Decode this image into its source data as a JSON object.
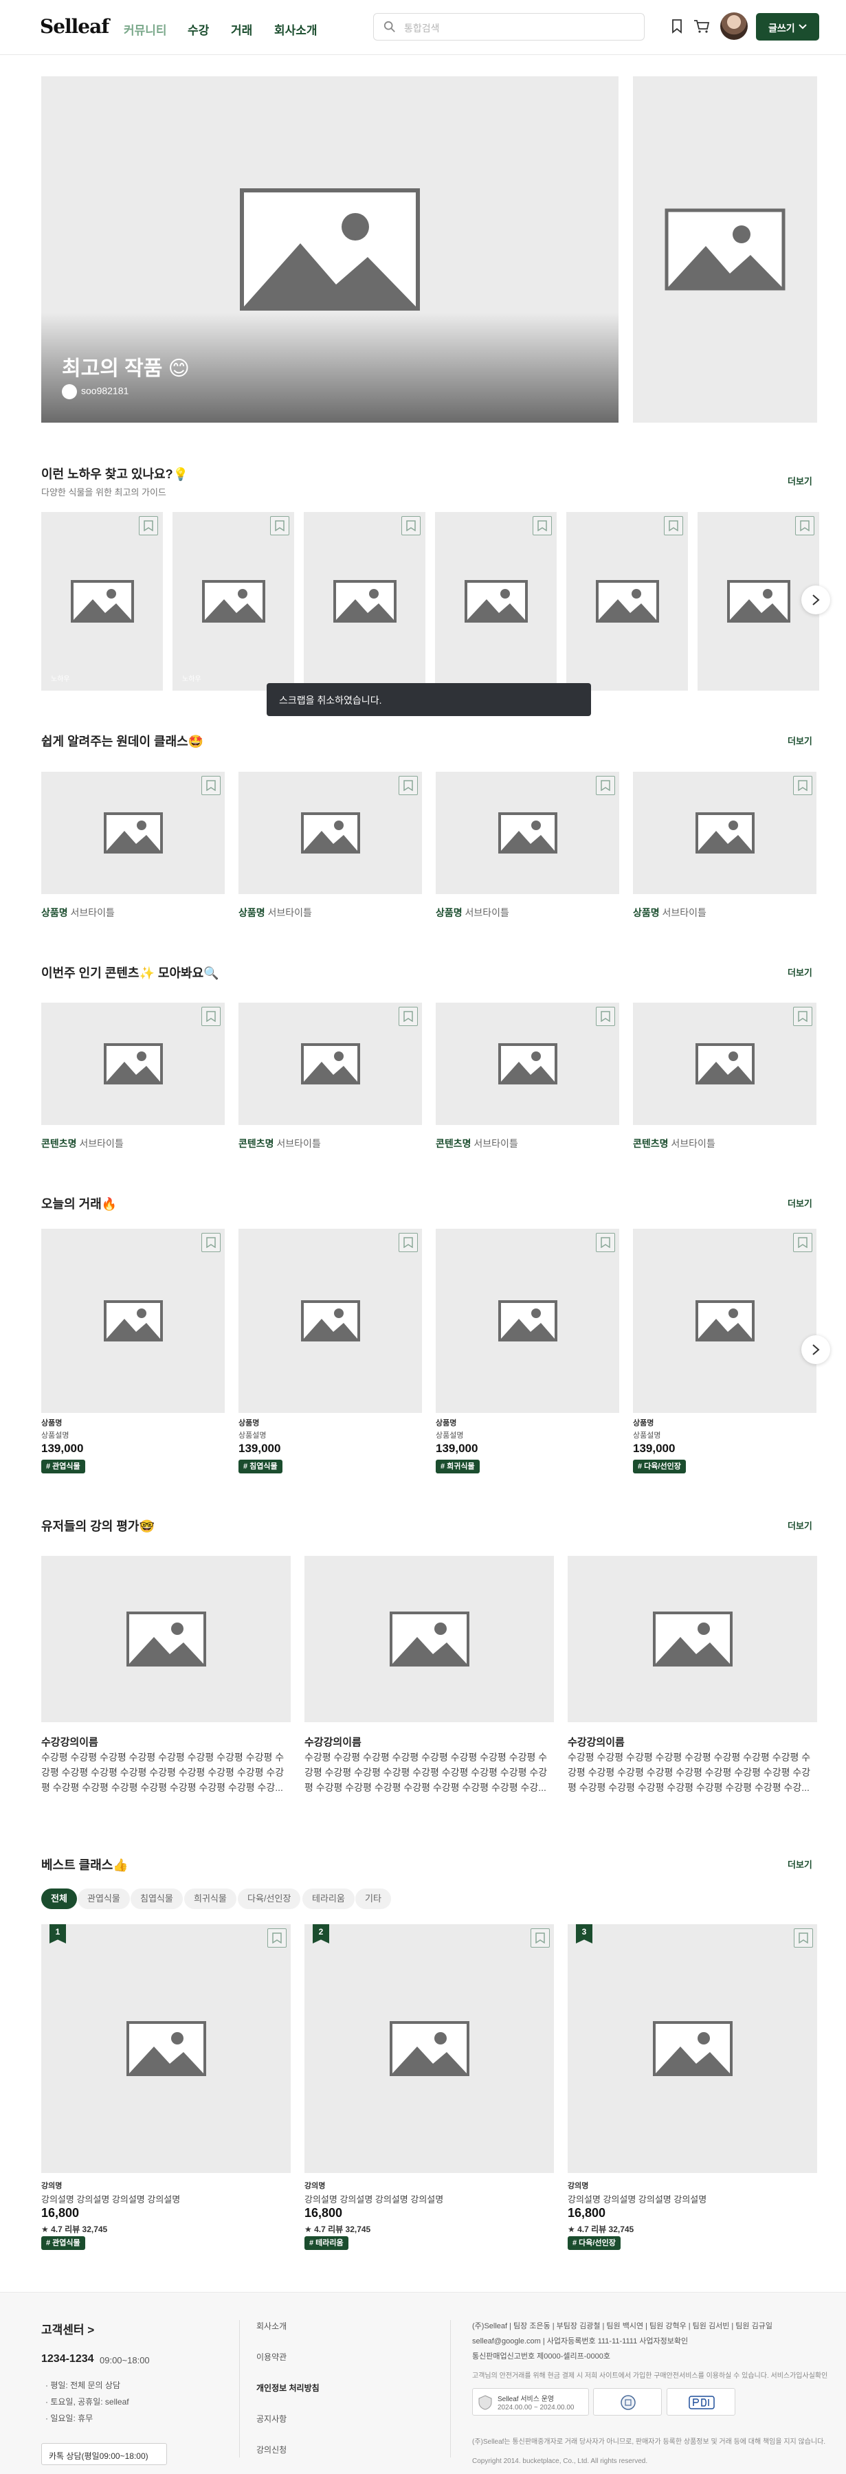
{
  "header": {
    "logo": "Selleaf",
    "nav": [
      "커뮤니티",
      "수강",
      "거래",
      "회사소개"
    ],
    "search_placeholder": "통합검색",
    "write_button": "글쓰기"
  },
  "hero": {
    "title": "최고의 작품 😊",
    "author": "soo982181"
  },
  "know_how": {
    "title": "이런 노하우 찾고 있나요?💡",
    "subtitle": "다양한 식물을 위한 최고의 가이드",
    "more": "더보기",
    "card_label": "노하우"
  },
  "toast": "스크랩을 취소하였습니다.",
  "oneday": {
    "title": "쉽게 알려주는 원데이 클래스🤩",
    "more": "더보기",
    "cards": [
      {
        "name": "상품명",
        "sub": "서브타이틀"
      },
      {
        "name": "상품명",
        "sub": "서브타이틀"
      },
      {
        "name": "상품명",
        "sub": "서브타이틀"
      },
      {
        "name": "상품명",
        "sub": "서브타이틀"
      }
    ]
  },
  "popular": {
    "title": "이번주 인기 콘텐츠✨ 모아봐요🔍",
    "more": "더보기",
    "cards": [
      {
        "name": "콘텐츠명",
        "sub": "서브타이틀"
      },
      {
        "name": "콘텐츠명",
        "sub": "서브타이틀"
      },
      {
        "name": "콘텐츠명",
        "sub": "서브타이틀"
      },
      {
        "name": "콘텐츠명",
        "sub": "서브타이틀"
      }
    ]
  },
  "trade": {
    "title": "오늘의 거래🔥",
    "more": "더보기",
    "cards": [
      {
        "cat": "상품명",
        "desc": "상품설명",
        "price": "139,000",
        "tag": "# 관엽식물"
      },
      {
        "cat": "상품명",
        "desc": "상품설명",
        "price": "139,000",
        "tag": "# 침엽식물"
      },
      {
        "cat": "상품명",
        "desc": "상품설명",
        "price": "139,000",
        "tag": "# 희귀식물"
      },
      {
        "cat": "상품명",
        "desc": "상품설명",
        "price": "139,000",
        "tag": "# 다육/선인장"
      }
    ]
  },
  "reviews": {
    "title": "유저들의 강의 평가🤓",
    "more": "더보기",
    "cards": [
      {
        "title": "수강강의이름",
        "body": "수강평 수강평 수강평 수강평 수강평 수강평 수강평 수강평 수강평 수강평 수강평 수강평 수강평 수강평 수강평 수강평 수강평 수강평 수강평 수강평 수강평 수강평 수강평 수강평 수강..."
      },
      {
        "title": "수강강의이름",
        "body": "수강평 수강평 수강평 수강평 수강평 수강평 수강평 수강평 수강평 수강평 수강평 수강평 수강평 수강평 수강평 수강평 수강평 수강평 수강평 수강평 수강평 수강평 수강평 수강평 수강..."
      },
      {
        "title": "수강강의이름",
        "body": "수강평 수강평 수강평 수강평 수강평 수강평 수강평 수강평 수강평 수강평 수강평 수강평 수강평 수강평 수강평 수강평 수강평 수강평 수강평 수강평 수강평 수강평 수강평 수강평 수강..."
      }
    ]
  },
  "best": {
    "title": "베스트 클래스👍",
    "more": "더보기",
    "chips": [
      "전체",
      "관엽식물",
      "침엽식물",
      "희귀식물",
      "다육/선인장",
      "테라리움",
      "기타"
    ],
    "cards": [
      {
        "rank": "1",
        "cat": "강의명",
        "desc": "강의설명 강의설명 강의설명 강의설명",
        "price": "16,800",
        "rating": "★ 4.7 리뷰 32,745",
        "tag": "# 관엽식물"
      },
      {
        "rank": "2",
        "cat": "강의명",
        "desc": "강의설명 강의설명 강의설명 강의설명",
        "price": "16,800",
        "rating": "★ 4.7 리뷰 32,745",
        "tag": "# 테라리움"
      },
      {
        "rank": "3",
        "cat": "강의명",
        "desc": "강의설명 강의설명 강의설명 강의설명",
        "price": "16,800",
        "rating": "★ 4.7 리뷰 32,745",
        "tag": "# 다육/선인장"
      }
    ]
  },
  "footer": {
    "cs_title": "고객센터 >",
    "phone": "1234-1234",
    "hours": "09:00~18:00",
    "notes": [
      "· 평일: 전체 문의 상담",
      "· 토요일, 공휴일: selleaf",
      "· 일요일: 휴무"
    ],
    "chat_button": "카톡 상담(평일09:00~18:00)",
    "links": [
      "회사소개",
      "이용약관",
      "개인정보 처리방침",
      "공지사항",
      "강의신청"
    ],
    "company_line": "(주)Selleaf  |  팀장 조은동  |  부팀장 김광철  |  팀원 백시연  |  팀원 강혁우  |  팀원 김서빈  |  팀원 김규일",
    "email_line": "selleaf@google.com  |  사업자등록번호 111-11-1111 사업자정보확인",
    "license_line": "통신판매업신고번호 제0000-셀리프-0000호",
    "notice_line": "고객님의 안전거래를 위해 현금 결제 시 저희 사이트에서 가입한 구매안전서비스를 이용하실 수 있습니다. 서비스가입사실확인",
    "badge1_title": "Selleaf 서비스 운영",
    "badge1_date": "2024.00.00 ~ 2024.00.00",
    "disclaimer": "(주)Selleaf는 통신판매중개자로 거래 당사자가 아니므로, 판매자가 등록한 상품정보 및 거래 등에 대해 책임을 지지 않습니다.",
    "copyright": "Copyright 2014. bucketplace, Co., Ltd. All rights reserved."
  }
}
